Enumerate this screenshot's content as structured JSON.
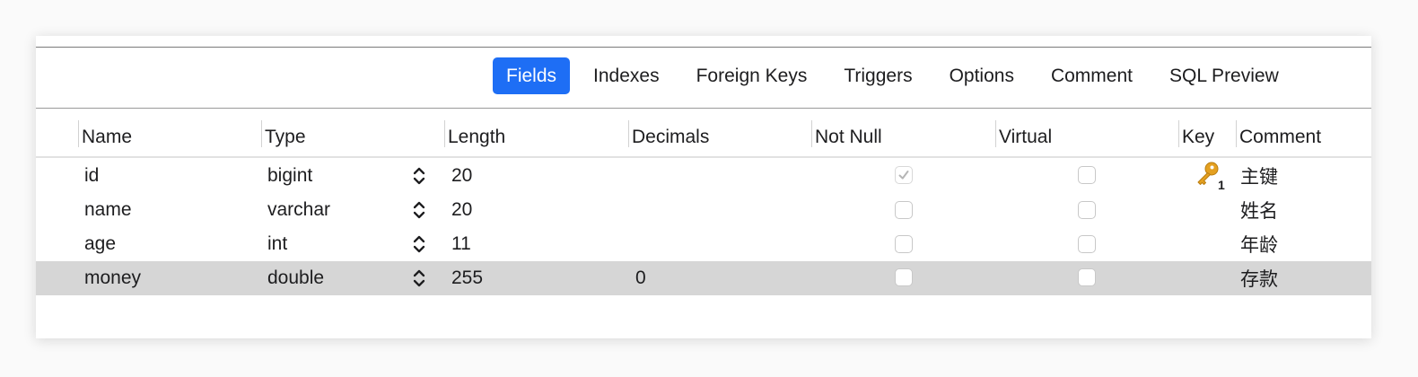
{
  "tabs": [
    {
      "label": "Fields",
      "active": true
    },
    {
      "label": "Indexes",
      "active": false
    },
    {
      "label": "Foreign Keys",
      "active": false
    },
    {
      "label": "Triggers",
      "active": false
    },
    {
      "label": "Options",
      "active": false
    },
    {
      "label": "Comment",
      "active": false
    },
    {
      "label": "SQL Preview",
      "active": false
    }
  ],
  "columns": {
    "name": "Name",
    "type": "Type",
    "length": "Length",
    "decimals": "Decimals",
    "not_null": "Not Null",
    "virtual": "Virtual",
    "key": "Key",
    "comment": "Comment"
  },
  "rows": [
    {
      "name": "id",
      "type": "bigint",
      "length": "20",
      "decimals": "",
      "not_null": true,
      "virtual": false,
      "key": "1",
      "comment": "主键",
      "selected": false
    },
    {
      "name": "name",
      "type": "varchar",
      "length": "20",
      "decimals": "",
      "not_null": false,
      "virtual": false,
      "key": "",
      "comment": "姓名",
      "selected": false
    },
    {
      "name": "age",
      "type": "int",
      "length": "11",
      "decimals": "",
      "not_null": false,
      "virtual": false,
      "key": "",
      "comment": "年龄",
      "selected": false
    },
    {
      "name": "money",
      "type": "double",
      "length": "255",
      "decimals": "0",
      "not_null": false,
      "virtual": false,
      "key": "",
      "comment": "存款",
      "selected": true
    }
  ],
  "colors": {
    "accent": "#1e6ef5",
    "selected_row": "#d6d6d6",
    "key_icon": "#e4a020"
  },
  "icons": {
    "stepper": "up-down-chevron-icon",
    "primary_key": "key-icon"
  }
}
